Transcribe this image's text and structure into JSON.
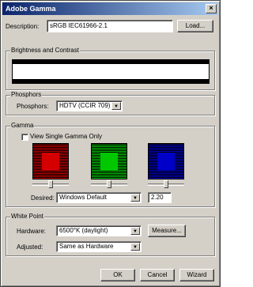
{
  "window": {
    "title": "Adobe Gamma",
    "close_symbol": "×"
  },
  "description": {
    "label": "Description:",
    "value": "sRGB IEC61966-2.1",
    "load_button": "Load..."
  },
  "brightness": {
    "group_label": "Brightness and Contrast"
  },
  "phosphors": {
    "group_label": "Phosphors",
    "label": "Phosphors:",
    "value": "HDTV (CCIR 709)"
  },
  "gamma": {
    "group_label": "Gamma",
    "checkbox_label": "View Single Gamma Only",
    "checkbox_checked": false,
    "desired_label": "Desired:",
    "desired_value": "Windows Default",
    "desired_number": "2.20",
    "swatch_colors": [
      "#d40000",
      "#00c800",
      "#0000c8"
    ]
  },
  "white_point": {
    "group_label": "White Point",
    "hardware_label": "Hardware:",
    "hardware_value": "6500°K (daylight)",
    "measure_button": "Measure...",
    "adjusted_label": "Adjusted:",
    "adjusted_value": "Same as Hardware"
  },
  "buttons": {
    "ok": "OK",
    "cancel": "Cancel",
    "wizard": "Wizard"
  },
  "dropdown_arrow": "▼"
}
